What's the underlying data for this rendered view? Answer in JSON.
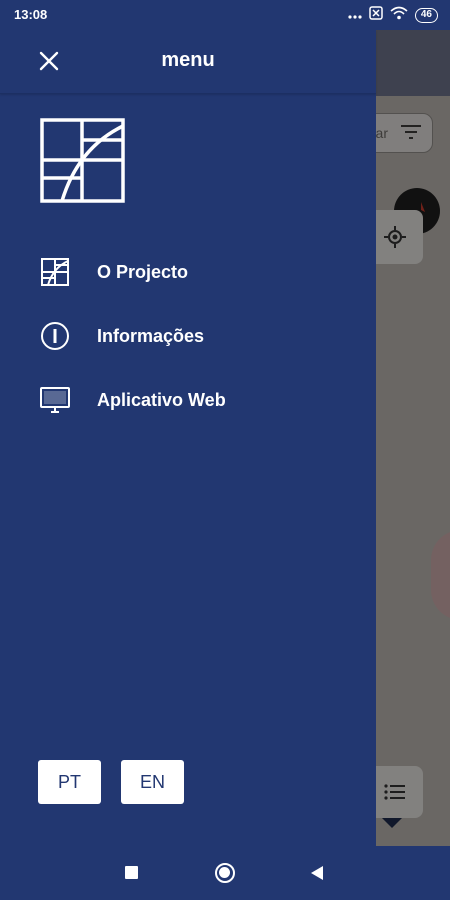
{
  "status_bar": {
    "time": "13:08",
    "battery": "46",
    "icons": [
      "more-icon",
      "sim-icon",
      "wifi-icon",
      "battery-icon"
    ]
  },
  "drawer": {
    "title": "menu",
    "close_icon": "close-icon",
    "logo": "project-logo",
    "items": [
      {
        "label": "O Projecto",
        "icon": "project-grid-icon"
      },
      {
        "label": "Informações",
        "icon": "info-icon"
      },
      {
        "label": "Aplicativo Web",
        "icon": "monitor-icon"
      }
    ],
    "languages": [
      "PT",
      "EN"
    ]
  },
  "background_app": {
    "search_text_fragment": "ar"
  },
  "nav_bar": {
    "icons": [
      "recents-icon",
      "home-icon",
      "back-icon"
    ]
  },
  "colors": {
    "drawer_background": "#223771",
    "text": "#ffffff",
    "language_button_text": "#223771"
  }
}
